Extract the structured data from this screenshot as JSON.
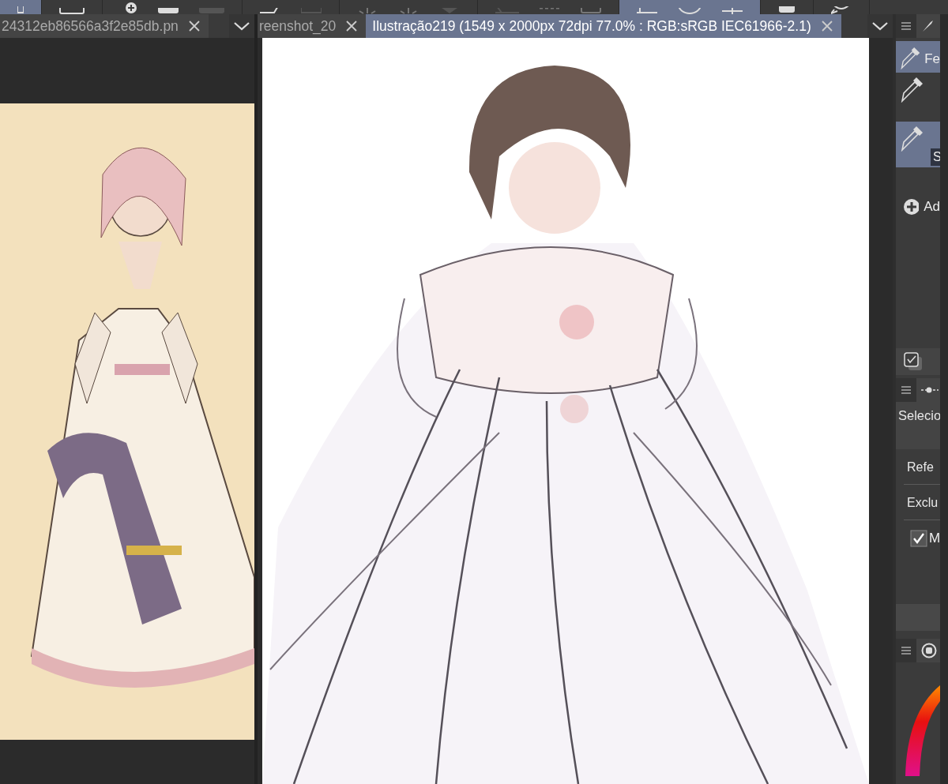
{
  "panes": [
    {
      "tabs": [
        {
          "label": "24312eb86566a3f2e85db.pn",
          "selected": false
        }
      ],
      "canvas": {
        "kind": "picture"
      }
    },
    {
      "tabs": [
        {
          "label": "reenshot_20",
          "selected": false
        },
        {
          "label": "Ilustração219 (1549 x 2000px 72dpi 77.0% : RGB:sRGB IEC61966-2.1)",
          "selected": true
        }
      ],
      "canvas": {
        "kind": "picture"
      }
    }
  ],
  "side_panel": {
    "tool_items": [
      {
        "label": "Fe",
        "selected": true
      },
      {
        "selected": false
      },
      {
        "label": "S",
        "selected": true
      }
    ],
    "add_button": "Ad",
    "settings": {
      "heading": "Selecio",
      "options": [
        "Refe",
        "Exclu"
      ],
      "checkbox": {
        "label": "M",
        "checked": true
      }
    }
  }
}
